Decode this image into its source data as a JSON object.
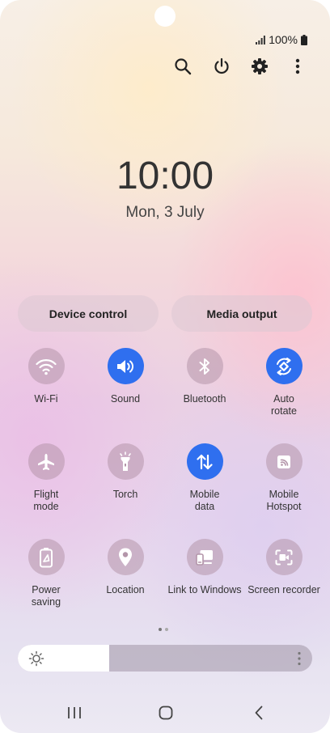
{
  "status_bar": {
    "battery_text": "100%",
    "icons": [
      "signal-icon",
      "battery-icon"
    ]
  },
  "header_icons": [
    "search-icon",
    "power-icon",
    "settings-icon",
    "more-icon"
  ],
  "clock": {
    "time": "10:00",
    "date": "Mon, 3 July"
  },
  "controls": {
    "device_control": "Device control",
    "media_output": "Media output"
  },
  "tiles": [
    {
      "label": "Wi-Fi",
      "icon": "wifi-icon",
      "active": false
    },
    {
      "label": "Sound",
      "icon": "sound-icon",
      "active": true
    },
    {
      "label": "Bluetooth",
      "icon": "bluetooth-icon",
      "active": false
    },
    {
      "label": "Auto\nrotate",
      "icon": "auto-rotate-icon",
      "active": true
    },
    {
      "label": "Flight\nmode",
      "icon": "flight-mode-icon",
      "active": false
    },
    {
      "label": "Torch",
      "icon": "torch-icon",
      "active": false
    },
    {
      "label": "Mobile\ndata",
      "icon": "mobile-data-icon",
      "active": true
    },
    {
      "label": "Mobile\nHotspot",
      "icon": "hotspot-icon",
      "active": false
    },
    {
      "label": "Power\nsaving",
      "icon": "power-saving-icon",
      "active": false
    },
    {
      "label": "Location",
      "icon": "location-icon",
      "active": false
    },
    {
      "label": "Link to Windows",
      "icon": "link-to-windows-icon",
      "active": false
    },
    {
      "label": "Screen recorder",
      "icon": "screen-recorder-icon",
      "active": false
    }
  ],
  "pager": {
    "pages": 2,
    "current": 1
  },
  "brightness": {
    "level": 0.31
  },
  "navigation": [
    "recent-apps-icon",
    "home-icon",
    "back-icon"
  ],
  "colors": {
    "accent": "#2f6fef",
    "tile_off": "#b496aa"
  }
}
